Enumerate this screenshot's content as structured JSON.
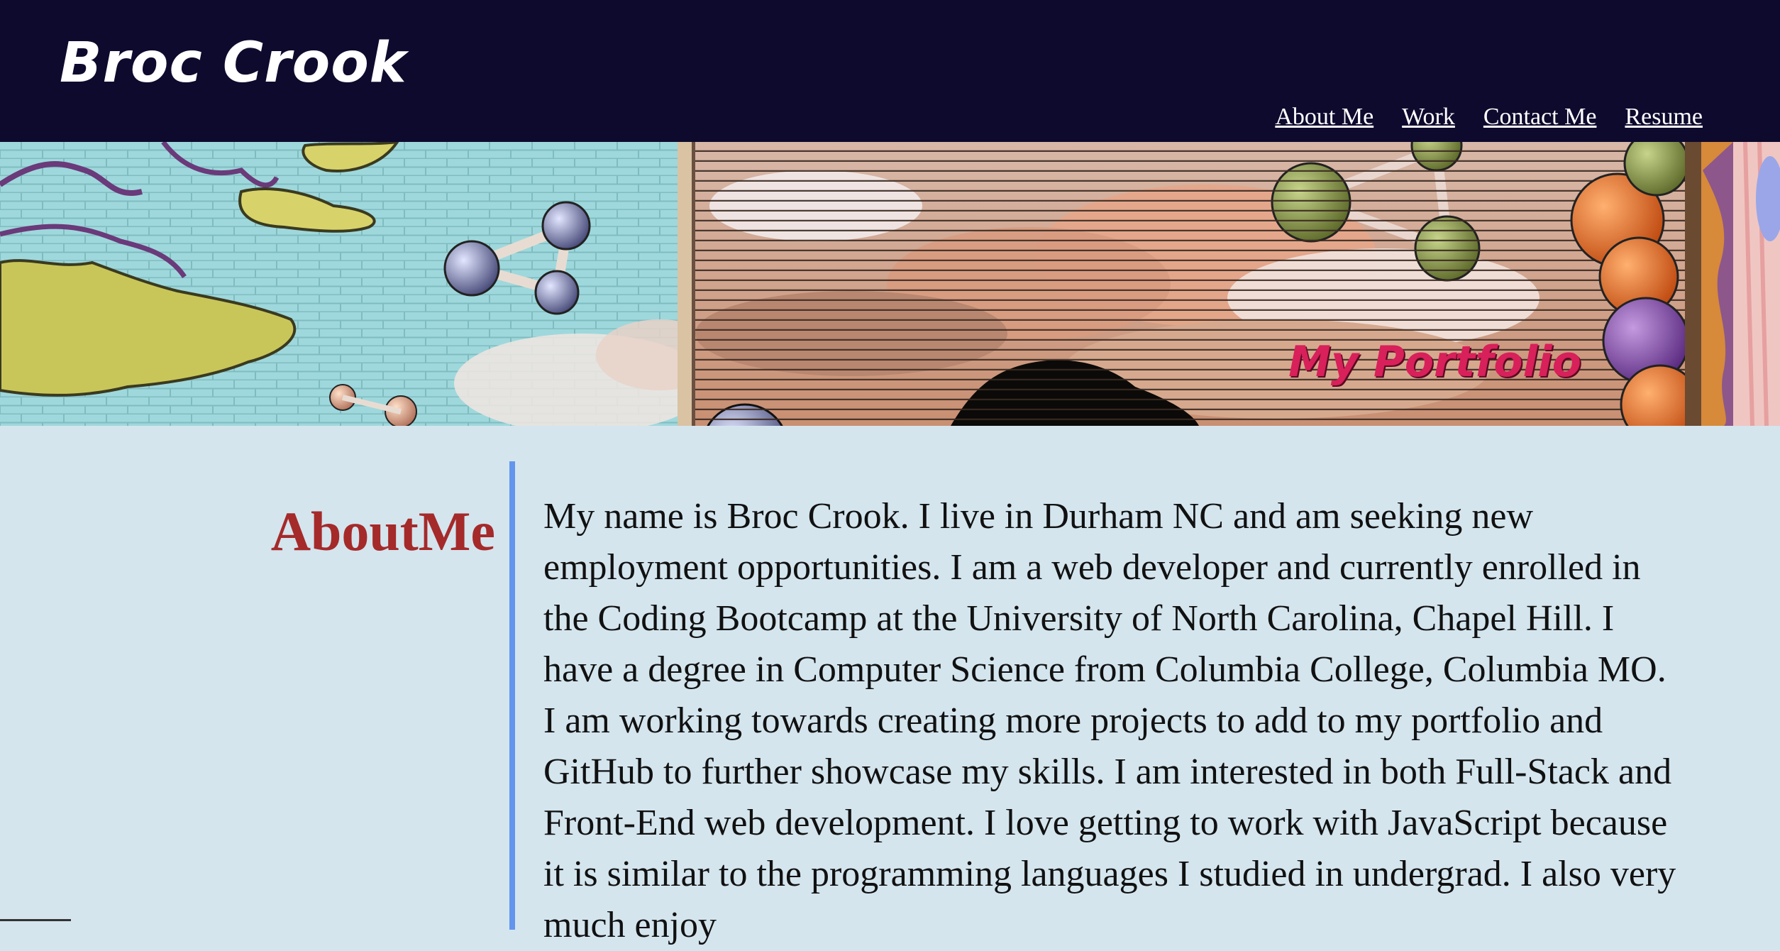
{
  "header": {
    "title": "Broc Crook",
    "nav": [
      "About Me",
      "Work",
      "Contact Me",
      "Resume"
    ]
  },
  "hero": {
    "caption": "My Portfolio"
  },
  "about": {
    "heading": "AboutMe",
    "text": "My name is Broc Crook. I live in Durham NC and am seeking new employment opportunities. I am a web developer and currently enrolled in the Coding Bootcamp at the University of North Carolina, Chapel Hill. I have a degree in Computer Science from Columbia College, Columbia MO. I am working towards creating more projects to add to my portfolio and GitHub to further showcase my skills. I am interested in both Full-Stack and Front-End web development. I love getting to work with JavaScript because it is similar to the programming languages I studied in undergrad. I also very much enjoy"
  },
  "colors": {
    "header_bg": "#0e0a2e",
    "page_bg": "#d4e5ee",
    "heading": "#a52a2a",
    "divider": "#6495ed",
    "caption": "#d8205a"
  }
}
